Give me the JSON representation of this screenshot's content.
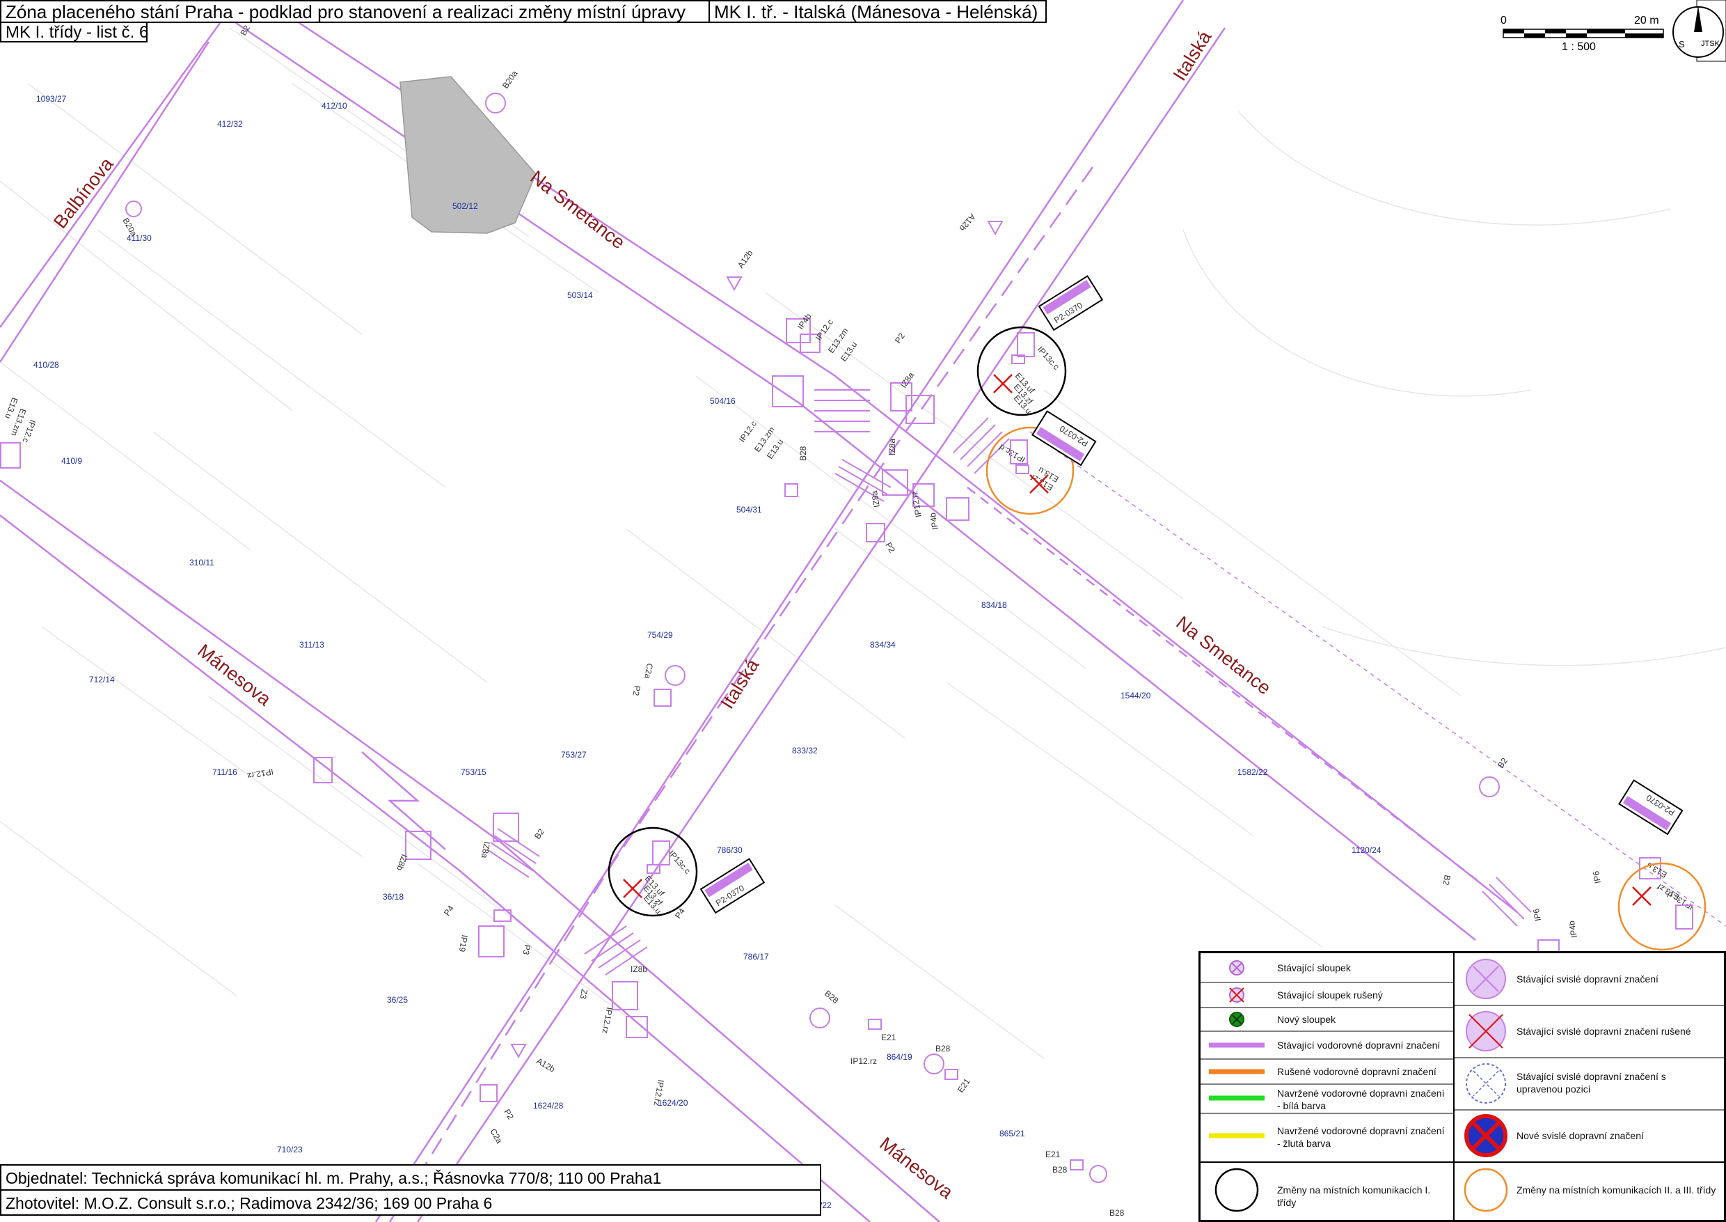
{
  "header": {
    "title": "Zóna placeného stání Praha - podklad pro stanovení a realizaci změny místní úpravy",
    "street_section": "MK I. tř. - Italská (Mánesova - Helénská)",
    "sheet": "MK I. třídy - list č. 6"
  },
  "scale": {
    "start": "0",
    "end": "20 m",
    "ratio": "1 : 500"
  },
  "north": {
    "letter": "S",
    "org": "JTSK"
  },
  "streets": {
    "balbinova": "Balbínova",
    "na_smetance_1": "Na Smetance",
    "na_smetance_2": "Na Smetance",
    "italska_1": "Italská",
    "italska_2": "Italská",
    "manesova_1": "Mánesova",
    "manesova_2": "Mánesova"
  },
  "parcels": [
    "1093/27",
    "412/10",
    "412/32",
    "502/12",
    "411/30",
    "503/14",
    "410/28",
    "410/9",
    "504/16",
    "504/31",
    "310/11",
    "754/29",
    "834/18",
    "834/34",
    "311/13",
    "712/14",
    "1544/20",
    "753/27",
    "833/32",
    "711/16",
    "753/15",
    "1582/22",
    "786/30",
    "1120/24",
    "36/18",
    "786/17",
    "36/25",
    "864/19",
    "1624/28",
    "1624/20",
    "865/21",
    "710/23",
    "/22"
  ],
  "signs": {
    "b20a_1": "B20a",
    "b20a_2": "B20a",
    "b2_top": "B2",
    "a12b_1": "A12b",
    "a12b_2": "A12b",
    "a12b_3": "A12b",
    "ip4b_1": "IP4b",
    "ip12c_1": "IP12.c",
    "e13zm_1": "E13.zm",
    "e13u_1": "E13.u",
    "p2_1": "P2",
    "iz8a_1": "IZ8a",
    "iz8a_2": "IZ8a",
    "iz8a_3": "IZ8a",
    "b28_1": "B28",
    "ip12c_2": "IP12.c",
    "e13zm_2": "E13.zm",
    "e13u_2": "E13.u",
    "ip13cc_1": "IP13c.c",
    "e13uf_1": "E13.uf",
    "e13zf_1": "E13.zf",
    "e13u_3": "E13.u",
    "p20370_1": "P2-0370",
    "p20370_2": "P2-0370",
    "p20370_3": "P2-0370",
    "p20370_4": "P2-0370",
    "ip13cd_1": "IP13c.d",
    "e13u_4": "E13.u",
    "e13zf_2": "E13.zf",
    "ip12rz_1": "IP12.rz",
    "ip4b_2": "IP4b",
    "p2_2": "P2",
    "e13u_left": "E13.u",
    "e13zm_left": "E13.zm",
    "ip12c_left": "IP12.c",
    "c2a_1": "C2a",
    "p2_3": "P2",
    "ip12rz_2": "IP12.rz",
    "iz8b": "IZ8b",
    "b2_2": "B2",
    "iz8a_4": "IZ8a",
    "p4_1": "P4",
    "ip19": "IP19",
    "p3": "P3",
    "ip13cc_2": "IP13c.c",
    "e13uf_2": "E13.uf",
    "e13zf_3": "E13.zf",
    "e13u_5": "E13.u",
    "p4_2": "P4",
    "b28_2": "B28",
    "e21_1": "E21",
    "b28_3": "B28",
    "ip12rz_3": "IP12.rz",
    "e21_2": "E21",
    "z3": "Z3",
    "iz8b_2": "IZ8b",
    "ip12rz_4": "IP12.rz",
    "ip12rz_5": "IP12.rz",
    "p2_4": "P2",
    "c2a_2": "C2a",
    "e21_3": "E21",
    "b28_4": "B28",
    "b28_5": "B28",
    "b2_3": "B2",
    "b2_4": "B2",
    "ip6_1": "IP6",
    "ip6_2": "IP6",
    "ip4b_3": "IP4b",
    "e13u_6": "E13.u",
    "e13zf_4": "E13.zf",
    "ip13cd_2": "IP13c.d"
  },
  "legend": {
    "existing_post": "Stávající sloupek",
    "existing_post_removed": "Stávající sloupek rušený",
    "new_post": "Nový sloupek",
    "existing_horizontal": "Stávající vodorovné dopravní značení",
    "removed_horizontal": "Rušené vodorovné dopravní značení",
    "proposed_white": "Navržené vodorovné dopravní značení - bílá barva",
    "proposed_yellow": "Navržené vodorovné dopravní značení - žlutá barva",
    "changes_class1": "Změny na místních komunikacích I. třídy",
    "existing_vertical": "Stávající svislé dopravní značení",
    "existing_vertical_removed": "Stávající svislé dopravní značení rušené",
    "existing_vertical_moved": "Stávající svislé dopravní značení s upravenou pozicí",
    "new_vertical": "Nové svislé dopravní značení",
    "changes_class23": "Změny na místních komunikacích II. a III. třídy"
  },
  "colors": {
    "existing": "#c77ee8",
    "removed_line": "#f28020",
    "proposed_white": "#22dd22",
    "proposed_yellow": "#f0ea00",
    "change_class23": "#f28c28",
    "street_label": "#8b1a1a",
    "parcel_label": "#1a2ea0",
    "new_sign_red": "#e01010",
    "new_sign_blue": "#2030c0"
  },
  "footer": {
    "client": "Objednatel: Technická správa komunikací hl. m. Prahy, a.s.; Řásnovka 770/8; 110 00 Praha1",
    "contractor": "Zhotovitel: M.O.Z. Consult s.r.o.; Radimova 2342/36; 169 00 Praha 6"
  }
}
